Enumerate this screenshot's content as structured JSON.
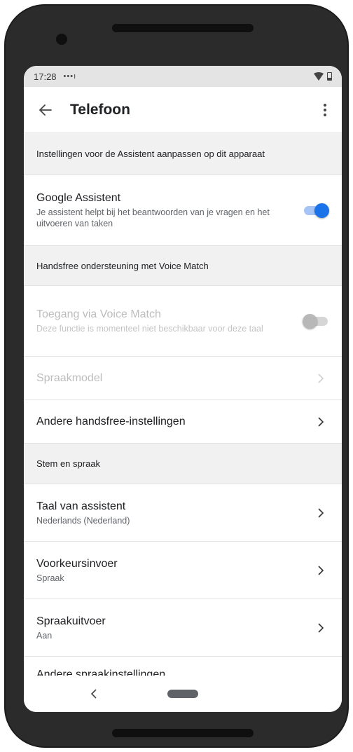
{
  "status_bar": {
    "time": "17:28",
    "notification_dots": "•••ı"
  },
  "app_bar": {
    "title": "Telefoon"
  },
  "sections": {
    "assistant_settings_header": "Instellingen voor de Assistent aanpassen op dit apparaat",
    "google_assistant": {
      "title": "Google Assistent",
      "subtitle": "Je assistent helpt bij het beantwoorden van je vragen en het uitvoeren van taken",
      "toggle": "on"
    },
    "handsfree_header": "Handsfree ondersteuning met Voice Match",
    "voice_match": {
      "title": "Toegang via Voice Match",
      "subtitle": "Deze functie is momenteel niet beschikbaar voor deze taal",
      "toggle": "off",
      "state": "disabled"
    },
    "voice_model": {
      "title": "Spraakmodel",
      "state": "disabled"
    },
    "other_handsfree": {
      "title": "Andere handsfree-instellingen"
    },
    "voice_header": "Stem en spraak",
    "assistant_language": {
      "title": "Taal van assistent",
      "subtitle": "Nederlands (Nederland)"
    },
    "preferred_input": {
      "title": "Voorkeursinvoer",
      "subtitle": "Spraak"
    },
    "speech_output": {
      "title": "Spraakuitvoer",
      "subtitle": "Aan"
    },
    "cutoff_row": {
      "title": "Andere spraakinstellingen"
    }
  },
  "colors": {
    "accent": "#1a73e8",
    "section_background": "#f1f1f1",
    "phone_frame": "#2b2b2b"
  },
  "icons": {
    "back": "arrow-left-icon",
    "more": "more-vert-icon",
    "chevron": "chevron-right-icon",
    "wifi": "wifi-icon",
    "battery": "battery-icon",
    "nav_back": "nav-back-icon",
    "nav_home": "home-pill-icon"
  }
}
